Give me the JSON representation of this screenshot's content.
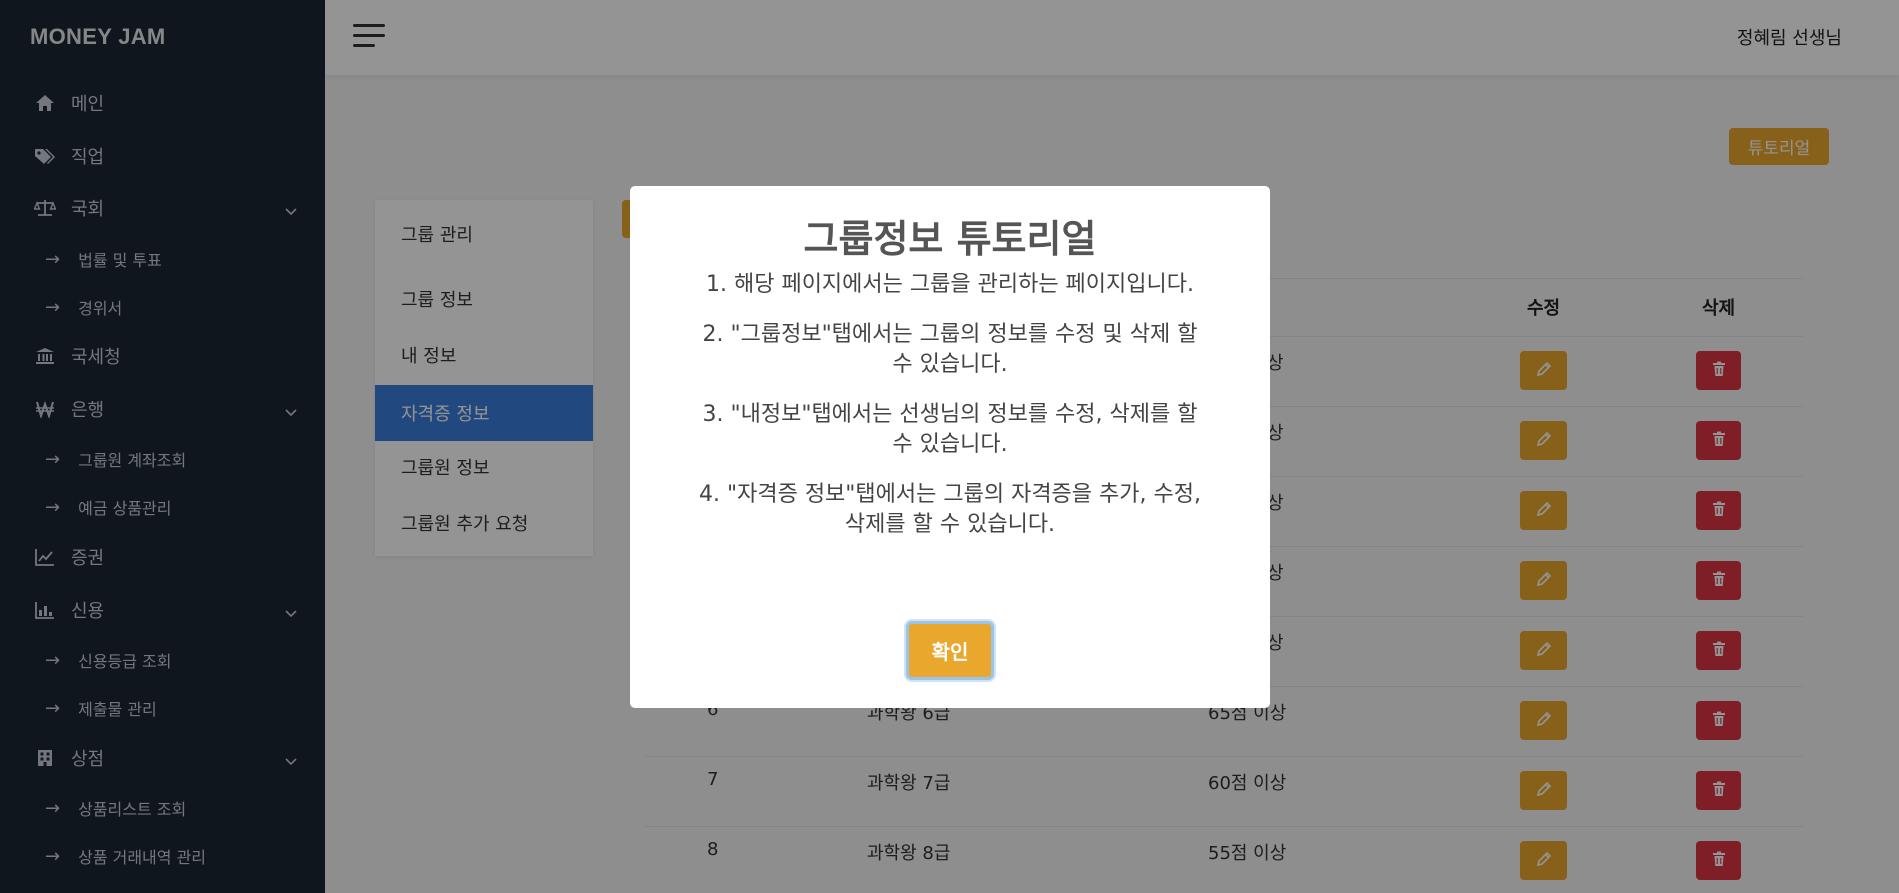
{
  "sidebar": {
    "brand": "MONEY JAM",
    "items": [
      {
        "label": "메인",
        "icon": "home-icon"
      },
      {
        "label": "직업",
        "icon": "tags-icon"
      },
      {
        "label": "국회",
        "icon": "balance-scale-icon"
      },
      {
        "label": "법률 및 투표"
      },
      {
        "label": "경위서"
      },
      {
        "label": "국세청",
        "icon": "bank-icon"
      },
      {
        "label": "은행",
        "icon": "won-icon"
      },
      {
        "label": "그룹원 계좌조회"
      },
      {
        "label": "예금 상품관리"
      },
      {
        "label": "증권",
        "icon": "line-chart-icon"
      },
      {
        "label": "신용",
        "icon": "bar-chart-icon"
      },
      {
        "label": "신용등급 조회"
      },
      {
        "label": "제출물 관리"
      },
      {
        "label": "상점",
        "icon": "building-icon"
      },
      {
        "label": "상품리스트 조회"
      },
      {
        "label": "상품 거래내역 관리"
      }
    ],
    "sub_arrow": "→"
  },
  "header": {
    "user_name": "정혜림 선생님"
  },
  "main": {
    "tutorial_button": "튜토리얼",
    "tabs": [
      {
        "label": "그룹 관리"
      },
      {
        "label": "그룹 정보"
      },
      {
        "label": "내 정보"
      },
      {
        "label": "자격증 정보"
      },
      {
        "label": "그룹원 정보"
      },
      {
        "label": "그룹원 추가 요청"
      }
    ],
    "table": {
      "headers": {
        "edit": "수정",
        "delete": "삭제"
      },
      "rows": [
        {
          "num": "",
          "name": "",
          "score": "상"
        },
        {
          "num": "",
          "name": "",
          "score": "상"
        },
        {
          "num": "",
          "name": "",
          "score": "상"
        },
        {
          "num": "",
          "name": "",
          "score": "상"
        },
        {
          "num": "",
          "name": "",
          "score": "상"
        },
        {
          "num": "6",
          "name": "과학왕 6급",
          "score": "65점 이상"
        },
        {
          "num": "7",
          "name": "과학왕 7급",
          "score": "60점 이상"
        },
        {
          "num": "8",
          "name": "과학왕 8급",
          "score": "55점 이상"
        }
      ]
    }
  },
  "modal": {
    "title": "그룹정보 튜토리얼",
    "steps": [
      "1. 해당 페이지에서는 그룹을 관리하는 페이지입니다.",
      "2. \"그룹정보\"탭에서는 그룹의 정보를 수정 및 삭제 할 수 있습니다.",
      "3. \"내정보\"탭에서는 선생님의 정보를 수정, 삭제를 할 수 있습니다.",
      "4. \"자격증 정보\"탭에서는 그룹의 자격증을 추가, 수정, 삭제를 할 수 있습니다."
    ],
    "confirm": "확인"
  },
  "colors": {
    "sidebar_bg": "#1b2633",
    "accent_yellow": "#e9a82d",
    "active_blue": "#3b7ddd",
    "danger_red": "#dc3545"
  }
}
